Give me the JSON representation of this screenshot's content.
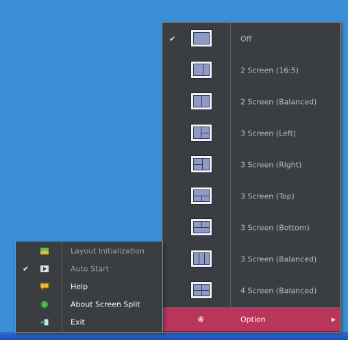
{
  "layout_menu": {
    "items": [
      {
        "label": "Off",
        "checked": true,
        "icon": "layout-full-icon"
      },
      {
        "label": "2 Screen (16:5)",
        "checked": false,
        "icon": "layout-2-wide-icon"
      },
      {
        "label": "2 Screen (Balanced)",
        "checked": false,
        "icon": "layout-2-balanced-icon"
      },
      {
        "label": "3 Screen (Left)",
        "checked": false,
        "icon": "layout-3-left-icon"
      },
      {
        "label": "3 Screen (Right)",
        "checked": false,
        "icon": "layout-3-right-icon"
      },
      {
        "label": "3 Screen (Top)",
        "checked": false,
        "icon": "layout-3-top-icon"
      },
      {
        "label": "3 Screen (Bottom)",
        "checked": false,
        "icon": "layout-3-bottom-icon"
      },
      {
        "label": "3 Screen (Balanced)",
        "checked": false,
        "icon": "layout-3-balanced-icon"
      },
      {
        "label": "4 Screen (Balanced)",
        "checked": false,
        "icon": "layout-4-balanced-icon"
      }
    ],
    "option": {
      "label": "Option",
      "icon": "gear-icon",
      "highlight_color": "#b8355c"
    }
  },
  "option_submenu": {
    "items": [
      {
        "label": "Layout Initialization",
        "enabled": false,
        "checked": false,
        "icon": "layout-reset-icon"
      },
      {
        "label": "Auto Start",
        "enabled": false,
        "checked": true,
        "icon": "play-icon"
      },
      {
        "label": "Help",
        "enabled": true,
        "checked": false,
        "icon": "help-icon"
      },
      {
        "label": "About Screen Split",
        "enabled": true,
        "checked": false,
        "icon": "info-icon"
      },
      {
        "label": "Exit",
        "enabled": true,
        "checked": false,
        "icon": "exit-icon"
      }
    ]
  },
  "check_mark": "✔"
}
